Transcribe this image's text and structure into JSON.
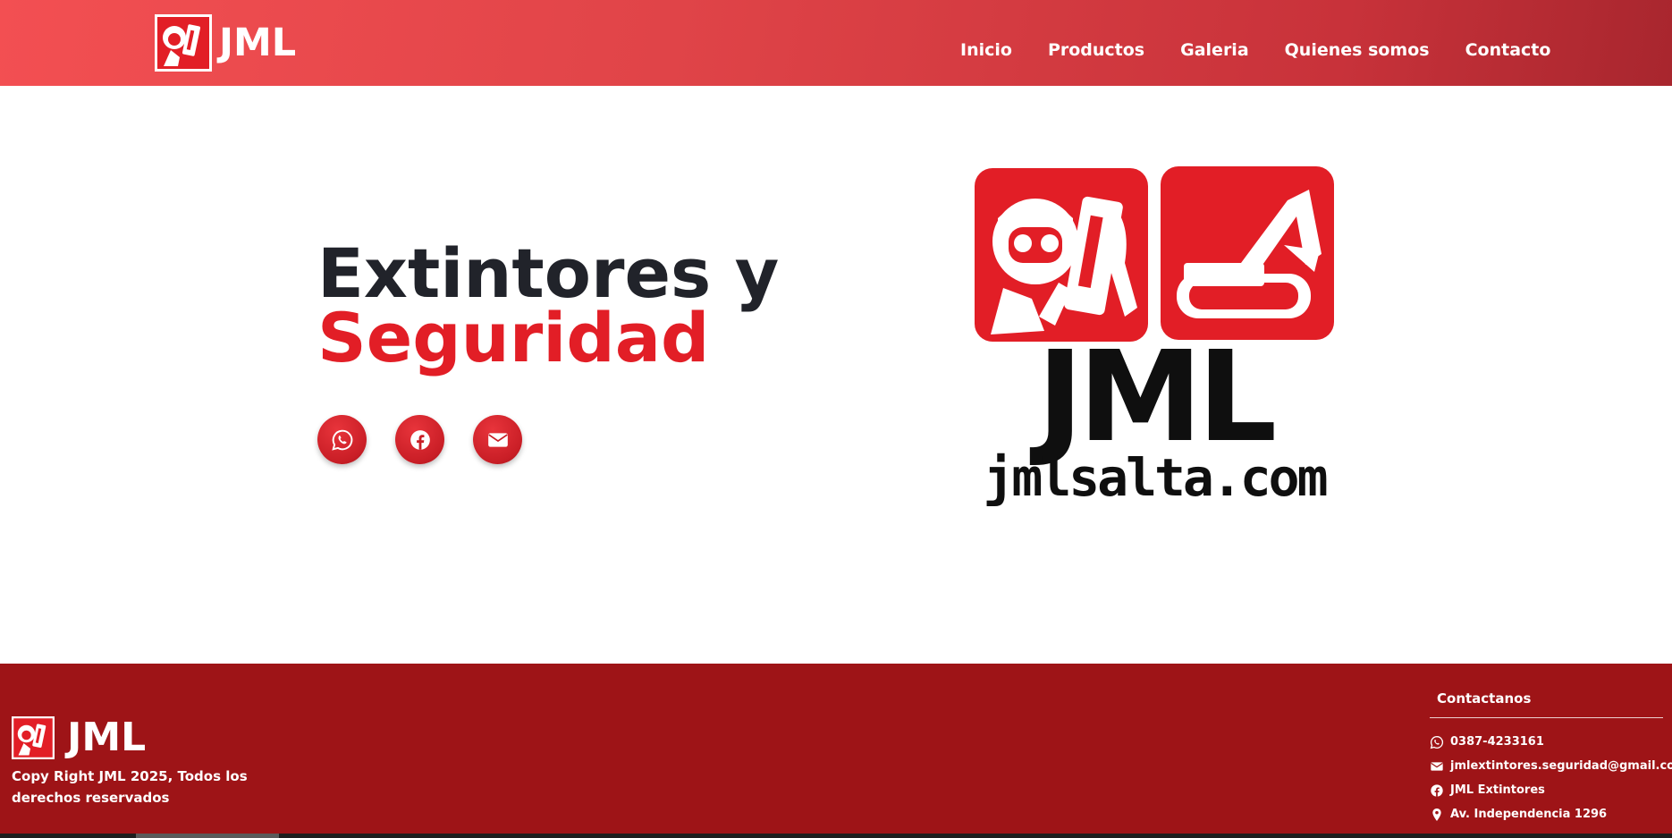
{
  "header": {
    "brand": "JML",
    "nav": [
      "Inicio",
      "Productos",
      "Galeria",
      "Quienes somos",
      "Contacto"
    ]
  },
  "hero": {
    "title_line1": "Extintores y",
    "title_line2": "Seguridad",
    "socials": [
      "whatsapp-icon",
      "facebook-icon",
      "envelope-icon"
    ],
    "logo_text": "JML",
    "logo_url": "jmlsalta.com"
  },
  "footer": {
    "brand": "JML",
    "copyright": "Copy Right JML 2025, Todos los derechos reservados",
    "contact_title": "Contactanos",
    "contacts": [
      {
        "icon": "whatsapp-icon",
        "text": "0387-4233161"
      },
      {
        "icon": "envelope-icon",
        "text": "jmlextintores.seguridad@gmail.com"
      },
      {
        "icon": "facebook-icon",
        "text": "JML Extintores"
      },
      {
        "icon": "map-pin-icon",
        "text": "Av. Independencia 1296"
      }
    ]
  },
  "colors": {
    "brand_red": "#e21e26",
    "footer_red": "#9e1417",
    "dark_text": "#21232a"
  }
}
